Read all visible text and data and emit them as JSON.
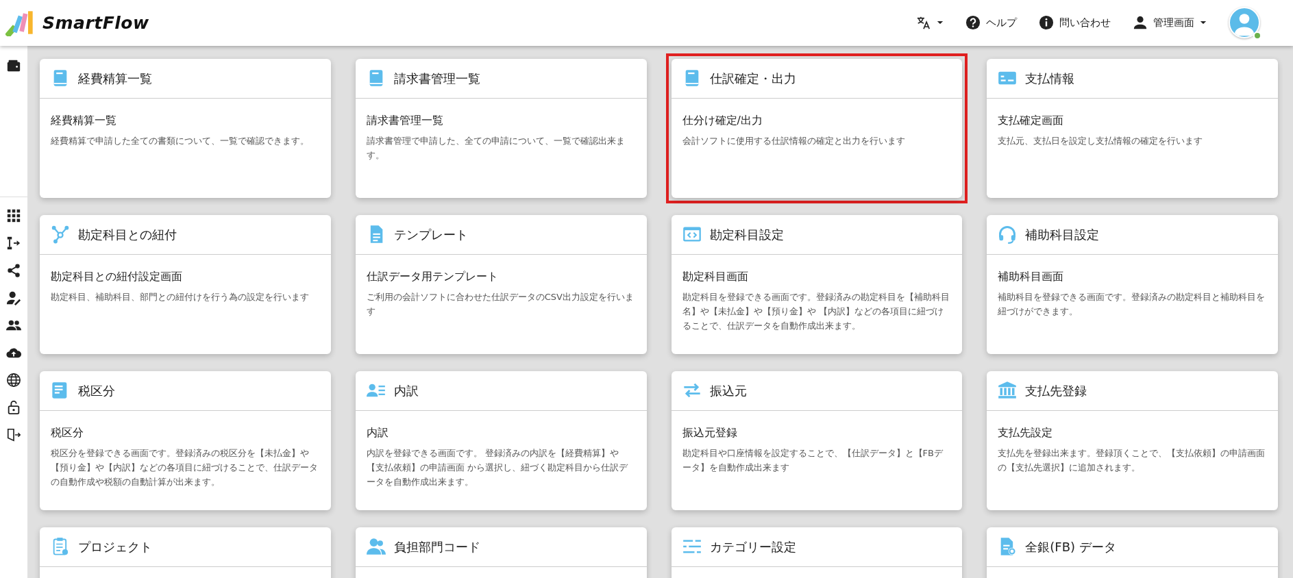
{
  "header": {
    "logo_text": "SmartFlow",
    "menus": [
      {
        "kind": "language",
        "dropdown": true
      },
      {
        "kind": "help",
        "label": "ヘルプ",
        "dropdown": false
      },
      {
        "kind": "contact",
        "label": "問い合わせ",
        "dropdown": false
      },
      {
        "kind": "admin",
        "label": "管理画面",
        "dropdown": true
      }
    ],
    "avatar": {
      "online": true
    }
  },
  "cards": [
    {
      "title": "経費精算一覧",
      "highlighted": false,
      "subtitle": "経費精算一覧",
      "description": "経費精算で申請した全ての書類について、一覧で確認できます。"
    },
    {
      "title": "請求書管理一覧",
      "highlighted": false,
      "subtitle": "請求書管理一覧",
      "description": "請求書管理で申請した、全ての申請について、一覧で確認出来ます。"
    },
    {
      "title": "仕訳確定・出力",
      "highlighted": true,
      "subtitle": "仕分け確定/出力",
      "description": "会計ソフトに使用する仕訳情報の確定と出力を行います"
    },
    {
      "title": "支払情報",
      "highlighted": false,
      "subtitle": "支払確定画面",
      "description": "支払元、支払日を設定し支払情報の確定を行います"
    },
    {
      "title": "勘定科目との紐付",
      "highlighted": false,
      "subtitle": "勘定科目との紐付設定画面",
      "description": "勘定科目、補助科目、部門との紐付けを行う為の設定を行います"
    },
    {
      "title": "テンプレート",
      "highlighted": false,
      "subtitle": "仕訳データ用テンプレート",
      "description": "ご利用の会計ソフトに合わせた仕訳データのCSV出力設定を行います"
    },
    {
      "title": "勘定科目設定",
      "highlighted": false,
      "subtitle": "勘定科目画面",
      "description": "勘定科目を登録できる画面です。登録済みの勘定科目を【補助科目名】や【未払金】や【預り金】や 【内訳】などの各項目に紐づけることで、仕訳データを自動作成出来ます。"
    },
    {
      "title": "補助科目設定",
      "highlighted": false,
      "subtitle": "補助科目画面",
      "description": "補助科目を登録できる画面です。登録済みの勘定科目と補助科目を紐づけができます。"
    },
    {
      "title": "税区分",
      "highlighted": false,
      "subtitle": "税区分",
      "description": "税区分を登録できる画面です。登録済みの税区分を【未払金】や【預り金】や【内訳】などの各項目に紐づけることで、仕訳データの自動作成や税額の自動計算が出来ます。"
    },
    {
      "title": "内訳",
      "highlighted": false,
      "subtitle": "内訳",
      "description": "内訳を登録できる画面です。 登録済みの内訳を【経費精算】や【支払依頼】の申請画面 から選択し、紐づく勘定科目から仕訳データを自動作成出来ます。"
    },
    {
      "title": "振込元",
      "highlighted": false,
      "subtitle": "振込元登録",
      "description": "勘定科目や口座情報を設定することで、【仕訳データ】と【FBデータ】を自動作成出来ます"
    },
    {
      "title": "支払先登録",
      "highlighted": false,
      "subtitle": "支払先設定",
      "description": "支払先を登録出来ます。登録頂くことで、【支払依頼】の申請画面の【支払先選択】に追加されます。"
    },
    {
      "title": "プロジェクト",
      "highlighted": false
    },
    {
      "title": "負担部門コード",
      "highlighted": false
    },
    {
      "title": "カテゴリー設定",
      "highlighted": false
    },
    {
      "title": "全銀(FB) データ",
      "highlighted": false
    }
  ]
}
